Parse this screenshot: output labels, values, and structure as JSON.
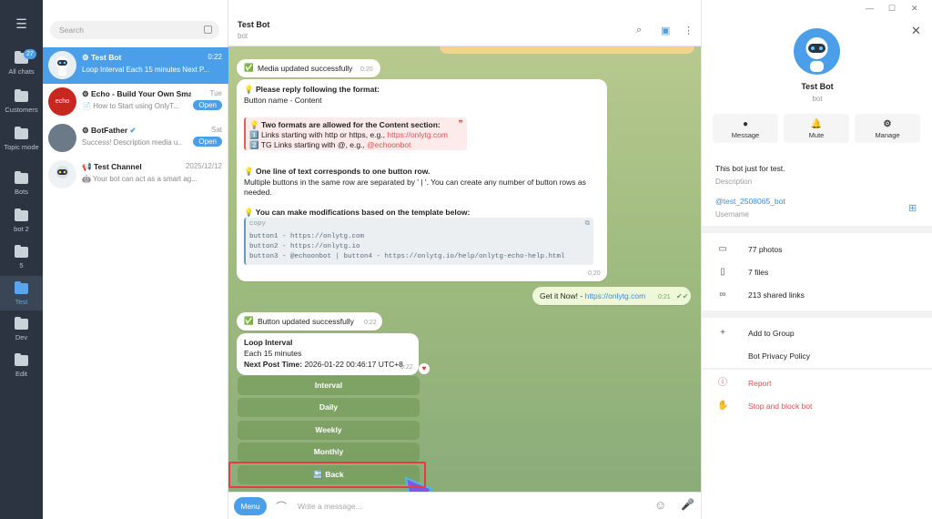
{
  "window": {
    "min": "—",
    "max": "☐",
    "close": "✕"
  },
  "folders": [
    {
      "label": "All chats",
      "badge": "27"
    },
    {
      "label": "Customers"
    },
    {
      "label": "Topic mode"
    },
    {
      "label": "Bots"
    },
    {
      "label": "bot 2"
    },
    {
      "label": "5"
    },
    {
      "label": "Test"
    },
    {
      "label": "Dev"
    },
    {
      "label": "Edit"
    }
  ],
  "search": {
    "placeholder": "Search"
  },
  "chats": [
    {
      "title": "Test Bot",
      "date": "0:22",
      "preview": "Loop Interval Each 15 minutes Next P..."
    },
    {
      "title": "Echo - Build Your Own Smar...",
      "date": "Tue",
      "preview": "How to Start using OnlyT...",
      "action": "Open"
    },
    {
      "title": "BotFather",
      "date": "Sat",
      "preview": "Success! Description media u...",
      "action": "Open"
    },
    {
      "title": "Test Channel",
      "date": "2025/12/12",
      "preview": "Your bot can act as a smart ag..."
    }
  ],
  "header": {
    "title": "Test Bot",
    "subtitle": "bot"
  },
  "messages": {
    "media_ok": "Media updated successfully",
    "media_ok_time": "0:20",
    "format_title": "Please reply following the format:",
    "format_line": "Button name - Content",
    "two_formats": "Two formats are allowed for the Content section:",
    "links_http": "Links starting with http or https, e.g., ",
    "links_http_url": "https://onlytg.com",
    "links_tg": "TG Links starting with @, e.g., ",
    "links_tg_handle": "@echoonbot",
    "one_line": "One line of text corresponds to one button row.",
    "multi_1": "Multiple buttons in the same row are separated by ' | '. You can create any number of button rows as",
    "multi_2": "needed.",
    "template_title": "You can make modifications based on the template below:",
    "code_label": "copy",
    "code_1": "button1 - https://onlytg.com",
    "code_2": "button2 - https://onlytg.io",
    "code_3": "button3 - @echoonbot | button4 - https://onlytg.io/help/onlytg-echo-help.html",
    "format_time": "0:20",
    "outgoing": "Get it Now! - ",
    "outgoing_link": "https://onlytg.com",
    "outgoing_time": "0:21",
    "button_ok": "Button updated successfully",
    "button_ok_time": "0:22",
    "loop_title": "Loop Interval",
    "loop_each": "Each 15 minutes",
    "next_label": "Next Post Time:",
    "next_value": " 2026-01-22 00:46:17 UTC+8",
    "loop_time": "0:22"
  },
  "keyboard": [
    "Interval",
    "Daily",
    "Weekly",
    "Monthly",
    "Back"
  ],
  "composer": {
    "menu": "Menu",
    "placeholder": "Write a message..."
  },
  "profile": {
    "name": "Test Bot",
    "subtitle": "bot",
    "actions": [
      "Message",
      "Mute",
      "Manage"
    ],
    "about": "This bot just for test.",
    "about_label": "Description",
    "username": "@test_2508065_bot",
    "username_label": "Username",
    "media": [
      "77 photos",
      "7 files",
      "213 shared links"
    ],
    "group": [
      "Add to Group",
      "Bot Privacy Policy"
    ],
    "danger": [
      "Report",
      "Stop and block bot"
    ]
  },
  "colors": {
    "accent": "#4a9fe8",
    "danger": "#e05050",
    "rail": "#2b3440",
    "highlight": "#e04040"
  }
}
